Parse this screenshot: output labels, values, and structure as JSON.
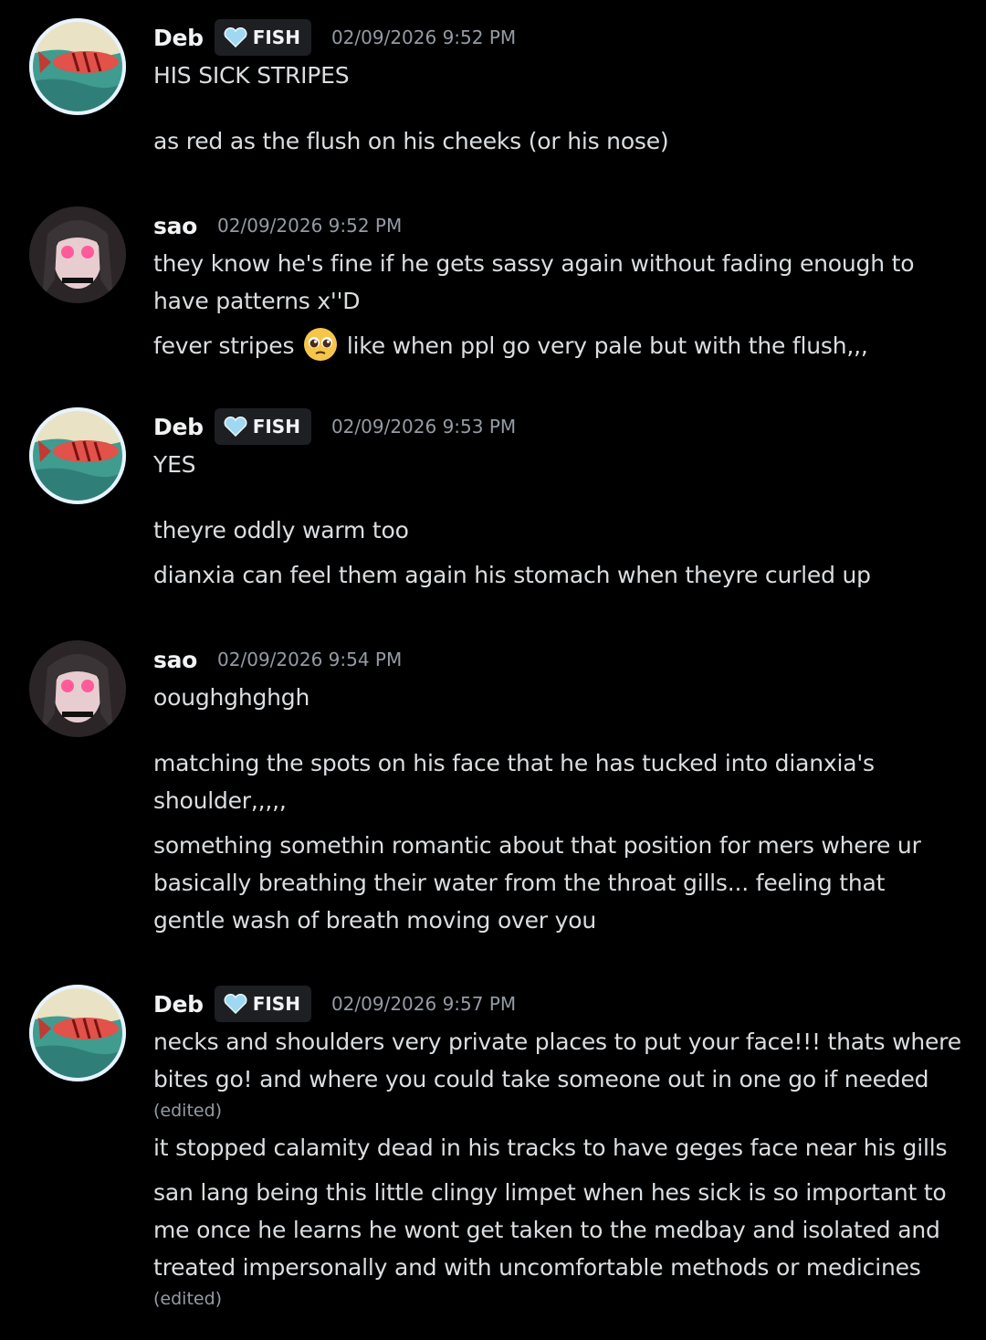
{
  "messages": [
    {
      "author": "Deb",
      "tag": "FISH",
      "timestamp": "02/09/2026 9:52 PM",
      "lines": [
        "HIS SICK STRIPES",
        "",
        "as red as the flush on his cheeks (or his nose)"
      ]
    },
    {
      "author": "sao",
      "timestamp": "02/09/2026 9:52 PM",
      "lines": [
        "they know he's fine if he gets sassy again without fading enough to",
        "have patterns x''D"
      ],
      "line_with_emoji": {
        "before": "fever stripes",
        "emoji": "pleading-face-emoji",
        "after": " like when ppl go very pale but with the flush,,,"
      }
    },
    {
      "author": "Deb",
      "tag": "FISH",
      "timestamp": "02/09/2026 9:53 PM",
      "lines": [
        "YES",
        "",
        "theyre oddly warm too",
        "dianxia can feel them again his stomach when theyre curled up"
      ]
    },
    {
      "author": "sao",
      "timestamp": "02/09/2026 9:54 PM",
      "lines": [
        "ooughghghgh",
        "",
        "matching the spots on his face that he has tucked into dianxia's",
        "shoulder,,,,,",
        "something somethin romantic about that position for mers where ur",
        "basically breathing their water from the throat gills... feeling that",
        "gentle wash of breath moving over you"
      ]
    },
    {
      "author": "Deb",
      "tag": "FISH",
      "timestamp": "02/09/2026 9:57 PM",
      "lines": [
        "necks and shoulders very private places to put your face!!! thats where",
        "bites go! and where you could take someone out in one go if needed",
        "it stopped calamity dead in his tracks to have geges face near his gills",
        "san lang being this little clingy limpet when hes sick is so important to",
        "me once he learns he wont get taken to the medbay and isolated and",
        "treated impersonally and with uncomfortable methods or medicines"
      ],
      "edited_label": "(edited)"
    }
  ],
  "colors": {
    "background": "#000000",
    "text": "#dbdee1",
    "username": "#f2f3f5",
    "timestamp": "#949ba4",
    "tag_bg": "#1e1f22",
    "heart_icon": "#9fd8f0"
  },
  "icons": {
    "tag": "heart-icon",
    "emoji": "pleading-face-emoji"
  }
}
